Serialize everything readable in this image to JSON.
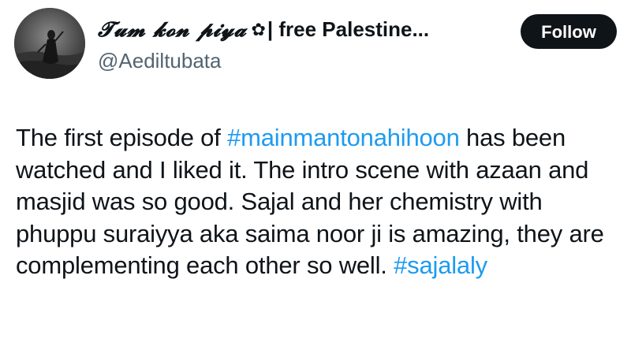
{
  "author": {
    "display_name": "𝓣𝓾𝓶 𝓴𝓸𝓷 𝓹𝓲𝔂𝓪",
    "name_symbol": "✿",
    "name_suffix": "| free Palestine...",
    "handle": "@Aediltubata",
    "avatar_icon": "avatar-photo"
  },
  "follow_button": {
    "label": "Follow",
    "bg_color": "#0f1419",
    "text_color": "#ffffff"
  },
  "tweet": {
    "text_1": "The first episode of ",
    "hashtag_1": "#mainmantonahihoon",
    "text_2": " has been watched and I liked it. The intro scene with azaan and masjid was so good. Sajal and her chemistry with phuppu suraiyya aka saima noor ji is amazing, they are complementing each other so well. ",
    "hashtag_2": "#sajalaly",
    "hashtag_color": "#1d9bf0"
  }
}
